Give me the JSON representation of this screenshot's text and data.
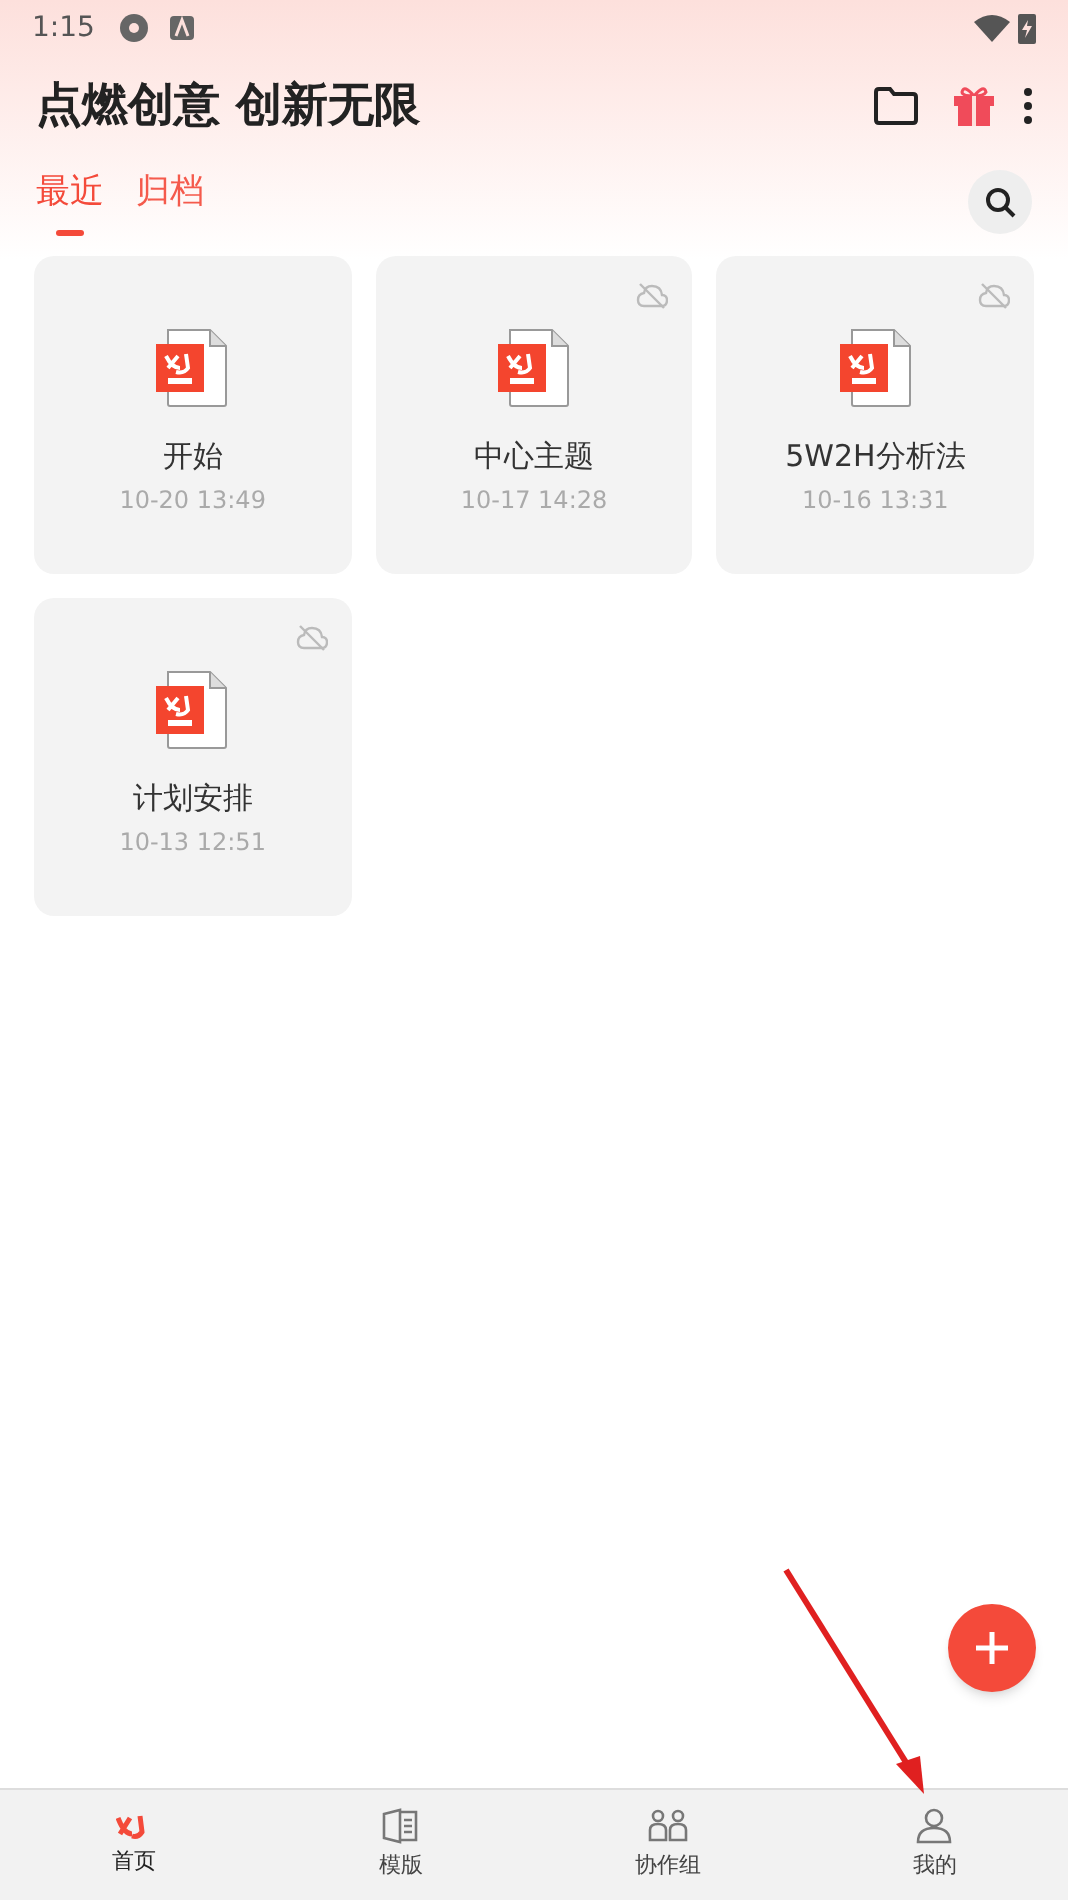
{
  "status_bar": {
    "time": "1:15"
  },
  "header": {
    "title": "点燃创意 创新无限"
  },
  "tabs": [
    {
      "label": "最近",
      "selected": true
    },
    {
      "label": "归档",
      "selected": false
    }
  ],
  "files": [
    {
      "name": "开始",
      "date": "10-20 13:49",
      "cloud_off": false
    },
    {
      "name": "中心主题",
      "date": "10-17 14:28",
      "cloud_off": true
    },
    {
      "name": "5W2H分析法",
      "date": "10-16 13:31",
      "cloud_off": true
    },
    {
      "name": "计划安排",
      "date": "10-13 12:51",
      "cloud_off": true
    }
  ],
  "bottom_nav": [
    {
      "label": "首页",
      "selected": true,
      "kind": "home"
    },
    {
      "label": "模版",
      "selected": false,
      "kind": "template"
    },
    {
      "label": "协作组",
      "selected": false,
      "kind": "group"
    },
    {
      "label": "我的",
      "selected": false,
      "kind": "profile"
    }
  ],
  "annotation_arrow": true
}
